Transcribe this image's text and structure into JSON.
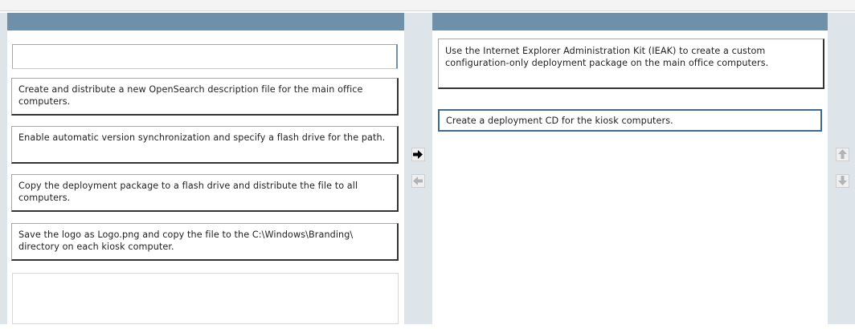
{
  "left_list": {
    "items": [
      "Create and distribute a new OpenSearch description file for the main office computers.",
      "Enable automatic version synchronization and specify a flash drive for the path.",
      "Copy the deployment package to a flash drive and distribute the file to all computers.",
      "Save the logo as Logo.png and copy the file to the C:\\Windows\\Branding\\ directory on each kiosk computer."
    ]
  },
  "right_list": {
    "items": [
      "Use the Internet Explorer Administration Kit (IEAK) to create a custom configuration-only deployment package on the main office computers.",
      "Create a deployment CD for the kiosk computers."
    ]
  },
  "controls": {
    "move_right_icon": "right-arrow-icon",
    "move_left_icon": "left-arrow-icon",
    "move_up_icon": "up-arrow-icon",
    "move_down_icon": "down-arrow-icon"
  },
  "colors": {
    "header_bar": "#6e90ab",
    "gutter": "#dde5ea",
    "selected_border": "#3e6a8e"
  }
}
